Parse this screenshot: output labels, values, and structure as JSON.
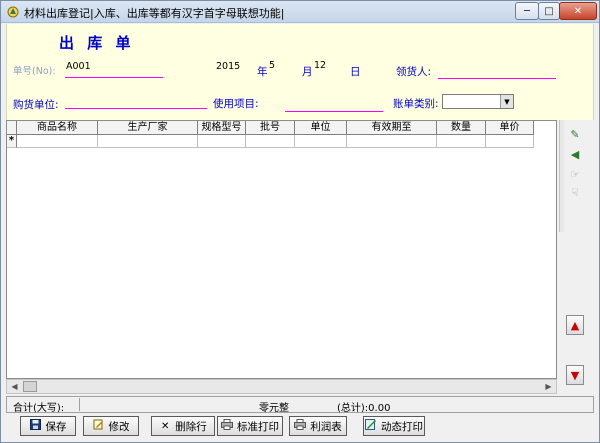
{
  "window": {
    "title": "材料出库登记|入库、出库等都有汉字首字母联想功能|",
    "minimize_glyph": "─",
    "maximize_glyph": "□",
    "close_glyph": "✕"
  },
  "header": {
    "form_title": "出 库 单",
    "doc_no_label": "单号(No):",
    "doc_no_value": "A001",
    "year_value": "2015",
    "year_label": "年",
    "month_value": "5",
    "month_label": "月",
    "day_value": "12",
    "day_label": "日",
    "picker_label": "领货人:",
    "buyer_label": "购货单位:",
    "project_label": "使用项目:",
    "category_label": "账单类别:",
    "combo_arrow": "▼"
  },
  "grid": {
    "columns": [
      "商品名称",
      "生产厂家",
      "规格型号",
      "批号",
      "单位",
      "有效期至",
      "数量",
      "单价"
    ],
    "new_row_marker": "*"
  },
  "sidebar": {
    "icons": [
      "✎",
      "◀",
      "☞",
      "☟"
    ],
    "up_arrow": "▲",
    "down_arrow": "▼"
  },
  "hscroll": {
    "left_arrow": "◀",
    "right_arrow": "▶"
  },
  "totals": {
    "label": "合计(大写):",
    "value_words": "零元整",
    "value_sum": "(总计):0.00"
  },
  "toolbar": {
    "save": "保存",
    "edit": "修改",
    "delete_row": "删除行",
    "standard_print": "标准打印",
    "profit_table": "利润表",
    "dynamic_print": "动态打印"
  },
  "colors": {
    "header_bg": "#ffffe1",
    "label_blue": "#0000cc",
    "underline_magenta": "#ff00ff",
    "arrow_red": "#cc0000"
  }
}
